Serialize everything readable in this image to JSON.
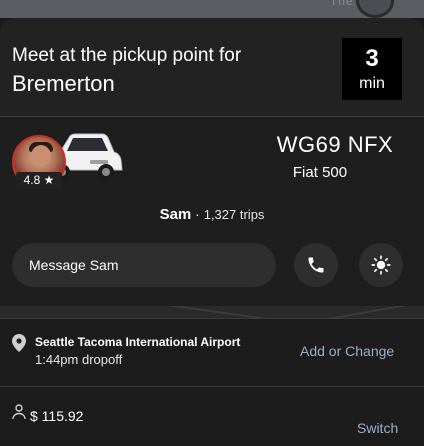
{
  "map": {
    "top_label": "The"
  },
  "header": {
    "line1": "Meet at the pickup point for",
    "line2": "Bremerton",
    "eta_value": "3",
    "eta_unit": "min"
  },
  "driver": {
    "rating": "4.8 ★",
    "plate": "WG69 NFX",
    "car_model": "Fiat 500",
    "name": "Sam",
    "separator": "·",
    "trips": "1,327 trips"
  },
  "actions": {
    "message_label": "Message Sam",
    "call_icon": "phone-icon",
    "light_icon": "brightness-icon"
  },
  "trip": {
    "destination": "Seattle Tacoma International Airport",
    "dropoff_time": "1:44pm dropoff",
    "add_change_label": "Add or Change",
    "fare": "$ 115.92",
    "switch_label": "Switch"
  },
  "colors": {
    "link": "#9ab0c7",
    "background": "#222222",
    "eta_box": "#000000"
  }
}
